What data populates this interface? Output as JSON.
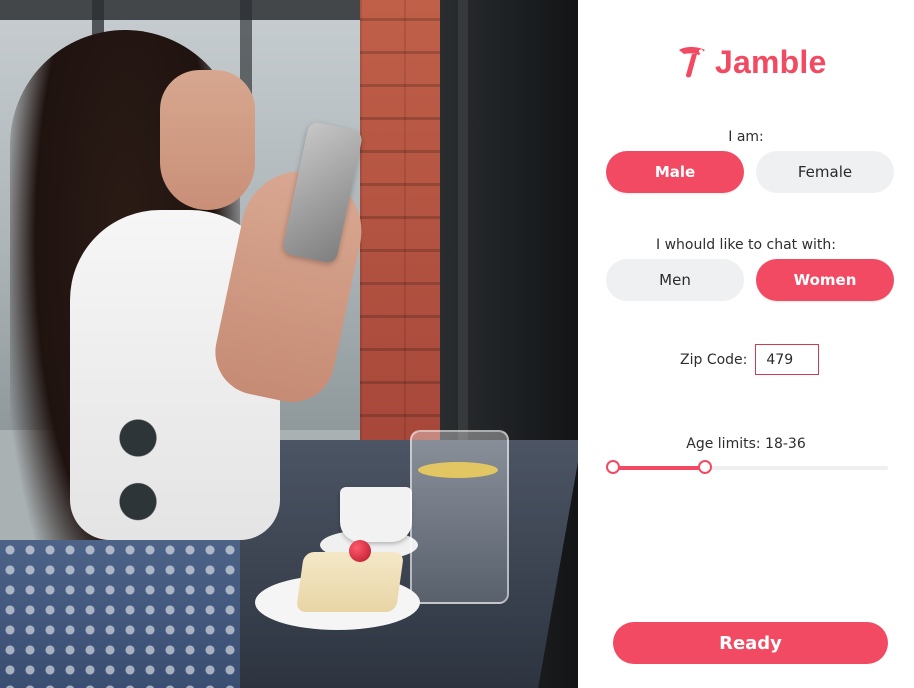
{
  "brand": {
    "name": "Jamble",
    "accent": "#f24a62"
  },
  "form": {
    "i_am_label": "I am:",
    "i_am_options": {
      "male": "Male",
      "female": "Female",
      "selected": "Male"
    },
    "chat_with_label": "I whould like to chat with:",
    "chat_with_options": {
      "men": "Men",
      "women": "Women",
      "selected": "Women"
    },
    "zip": {
      "label": "Zip Code:",
      "value": "479",
      "placeholder": ""
    },
    "age": {
      "label": "Age limits: 18-36",
      "min": 18,
      "max": 36,
      "slider_min_fraction": 0.0,
      "slider_max_fraction": 0.35
    },
    "ready_label": "Ready"
  },
  "icons": {
    "logo_mark": "jamble-bird-icon"
  }
}
